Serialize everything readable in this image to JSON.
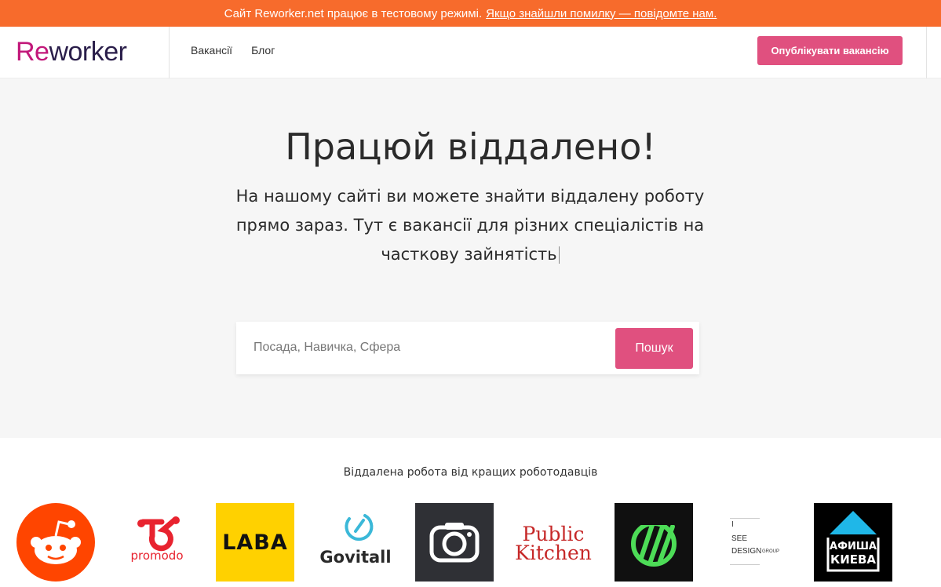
{
  "banner": {
    "text": "Сайт Reworker.net працює в тестовому режимі.",
    "link": "Якщо знайшли помилку — повідомте нам."
  },
  "header": {
    "logo_prefix": "Re",
    "logo_rest": "worker",
    "nav": [
      "Вакансії",
      "Блог"
    ],
    "publish_label": "Опублікувати вакансію"
  },
  "hero": {
    "title": "Працюй віддалено!",
    "subtitle": "На нашому сайті ви можете знайти віддалену роботу прямо зараз. Тут є вакансії для різних спеціалістів на часткову зайнятість"
  },
  "search": {
    "placeholder": "Посада, Навичка, Сфера",
    "button_label": "Пошук"
  },
  "employers": {
    "caption": "Віддалена робота від кращих роботодавців",
    "logos": [
      {
        "name": "reddit",
        "color": "#ff4500"
      },
      {
        "name": "promodo",
        "text": "promodo",
        "color": "#e8232f"
      },
      {
        "name": "laba",
        "text": "LABA",
        "color": "#ffd100"
      },
      {
        "name": "govitall",
        "text": "Govitall",
        "color": "#3bb8d8"
      },
      {
        "name": "camera",
        "color": "#2f3035"
      },
      {
        "name": "public-kitchen",
        "line1": "Public",
        "line2": "Kitchen",
        "color": "#c62828"
      },
      {
        "name": "green-stripes",
        "color": "#4ddc57"
      },
      {
        "name": "i-see-design",
        "line1": "I",
        "line2": "SEE",
        "line3": "DESIGN",
        "small": "GROUP"
      },
      {
        "name": "afisha-kieva",
        "line1": "АФИША",
        "line2": "КИЕВА",
        "color": "#1fb7e8"
      }
    ]
  }
}
